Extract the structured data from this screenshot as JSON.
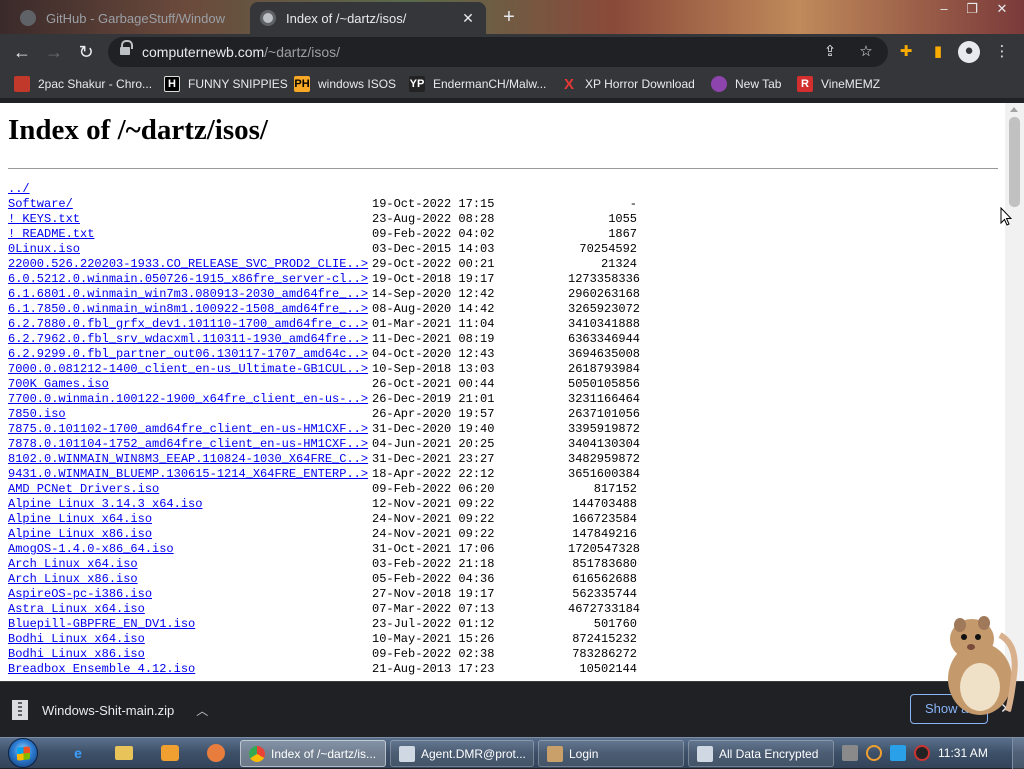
{
  "browser": {
    "tabs": [
      {
        "label": "GitHub - GarbageStuff/Window",
        "active": false
      },
      {
        "label": "Index of /~dartz/isos/",
        "active": true
      }
    ],
    "new_tab_label": "+",
    "window_controls": {
      "minimize": "–",
      "maximize": "❐",
      "close": "✕"
    },
    "url_host": "computernewb.com",
    "url_path": "/~dartz/isos/",
    "bookmarks": [
      {
        "label": "2pac Shakur - Chro...",
        "icon": "chrome-icon"
      },
      {
        "label": "FUNNY SNIPPIES",
        "icon": "h-icon"
      },
      {
        "label": "windows ISOS",
        "icon": "ph-icon"
      },
      {
        "label": "EndermanCH/Malw...",
        "icon": "yp-icon"
      },
      {
        "label": "XP Horror Download",
        "icon": "x-icon"
      },
      {
        "label": "New Tab",
        "icon": "globe-icon"
      },
      {
        "label": "VineMEMZ",
        "icon": "r-icon"
      }
    ]
  },
  "page": {
    "title": "Index of /~dartz/isos/",
    "parent_link": "../",
    "entries": [
      {
        "name": "Software/",
        "date": "19-Oct-2022 17:15",
        "size": "-"
      },
      {
        "name": "! KEYS.txt",
        "date": "23-Aug-2022 08:28",
        "size": "1055"
      },
      {
        "name": "! README.txt",
        "date": "09-Feb-2022 04:02",
        "size": "1867"
      },
      {
        "name": "0Linux.iso",
        "date": "03-Dec-2015 14:03",
        "size": "70254592"
      },
      {
        "name": "22000.526.220203-1933.CO_RELEASE_SVC_PROD2_CLIE..>",
        "date": "29-Oct-2022 00:21",
        "size": "21324"
      },
      {
        "name": "6.0.5212.0.winmain.050726-1915_x86fre_server-cl..>",
        "date": "19-Oct-2018 19:17",
        "size": "1273358336"
      },
      {
        "name": "6.1.6801.0.winmain_win7m3.080913-2030_amd64fre_..>",
        "date": "14-Sep-2020 12:42",
        "size": "2960263168"
      },
      {
        "name": "6.1.7850.0.winmain_win8m1.100922-1508_amd64fre_..>",
        "date": "08-Aug-2020 14:42",
        "size": "3265923072"
      },
      {
        "name": "6.2.7880.0.fbl_grfx_dev1.101110-1700_amd64fre_c..>",
        "date": "01-Mar-2021 11:04",
        "size": "3410341888"
      },
      {
        "name": "6.2.7962.0.fbl_srv_wdacxml.110311-1930_amd64fre..>",
        "date": "11-Dec-2021 08:19",
        "size": "6363346944"
      },
      {
        "name": "6.2.9299.0.fbl_partner_out06.130117-1707_amd64c..>",
        "date": "04-Oct-2020 12:43",
        "size": "3694635008"
      },
      {
        "name": "7000.0.081212-1400_client_en-us_Ultimate-GB1CUL..>",
        "date": "10-Sep-2018 13:03",
        "size": "2618793984"
      },
      {
        "name": "700K Games.iso",
        "date": "26-Oct-2021 00:44",
        "size": "5050105856"
      },
      {
        "name": "7700.0.winmain.100122-1900_x64fre_client_en-us-..>",
        "date": "26-Dec-2019 21:01",
        "size": "3231166464"
      },
      {
        "name": "7850.iso",
        "date": "26-Apr-2020 19:57",
        "size": "2637101056"
      },
      {
        "name": "7875.0.101102-1700_amd64fre_client_en-us-HM1CXF..>",
        "date": "31-Dec-2020 19:40",
        "size": "3395919872"
      },
      {
        "name": "7878.0.101104-1752_amd64fre_client_en-us-HM1CXF..>",
        "date": "04-Jun-2021 20:25",
        "size": "3404130304"
      },
      {
        "name": "8102.0.WINMAIN_WIN8M3_EEAP.110824-1030_X64FRE_C..>",
        "date": "31-Dec-2021 23:27",
        "size": "3482959872"
      },
      {
        "name": "9431.0.WINMAIN_BLUEMP.130615-1214_X64FRE_ENTERP..>",
        "date": "18-Apr-2022 22:12",
        "size": "3651600384"
      },
      {
        "name": "AMD PCNet Drivers.iso",
        "date": "09-Feb-2022 06:20",
        "size": "817152"
      },
      {
        "name": "Alpine Linux 3.14.3 x64.iso",
        "date": "12-Nov-2021 09:22",
        "size": "144703488"
      },
      {
        "name": "Alpine Linux x64.iso",
        "date": "24-Nov-2021 09:22",
        "size": "166723584"
      },
      {
        "name": "Alpine Linux x86.iso",
        "date": "24-Nov-2021 09:22",
        "size": "147849216"
      },
      {
        "name": "AmogOS-1.4.0-x86_64.iso",
        "date": "31-Oct-2021 17:06",
        "size": "1720547328"
      },
      {
        "name": "Arch Linux x64.iso",
        "date": "03-Feb-2022 21:18",
        "size": "851783680"
      },
      {
        "name": "Arch Linux x86.iso",
        "date": "05-Feb-2022 04:36",
        "size": "616562688"
      },
      {
        "name": "AspireOS-pc-i386.iso",
        "date": "27-Nov-2018 19:17",
        "size": "562335744"
      },
      {
        "name": "Astra Linux x64.iso",
        "date": "07-Mar-2022 07:13",
        "size": "4672733184"
      },
      {
        "name": "Bluepill-GBPFRE_EN_DV1.iso",
        "date": "23-Jul-2022 01:12",
        "size": "501760"
      },
      {
        "name": "Bodhi Linux x64.iso",
        "date": "10-May-2021 15:26",
        "size": "872415232"
      },
      {
        "name": "Bodhi Linux x86.iso",
        "date": "09-Feb-2022 02:38",
        "size": "783286272"
      },
      {
        "name": "Breadbox Ensemble 4.12.iso",
        "date": "21-Aug-2013 17:23",
        "size": "10502144"
      }
    ]
  },
  "downloads": {
    "filename": "Windows-Shit-main.zip",
    "show_all_label": "Show all"
  },
  "taskbar": {
    "tasks": [
      {
        "label": "Index of /~dartz/is...",
        "icon": "chrome-icon",
        "active": true
      },
      {
        "label": "Agent.DMR@prot...",
        "icon": "window-icon",
        "active": false
      },
      {
        "label": "Login",
        "icon": "app-icon",
        "active": false
      },
      {
        "label": "All Data Encrypted",
        "icon": "window-icon",
        "active": false
      }
    ],
    "clock": "11:31 AM"
  },
  "colors": {
    "link": "#0000ee",
    "chrome_dark": "#35363a",
    "omnibox": "#202124",
    "accent_blue": "#8ab4f8"
  }
}
